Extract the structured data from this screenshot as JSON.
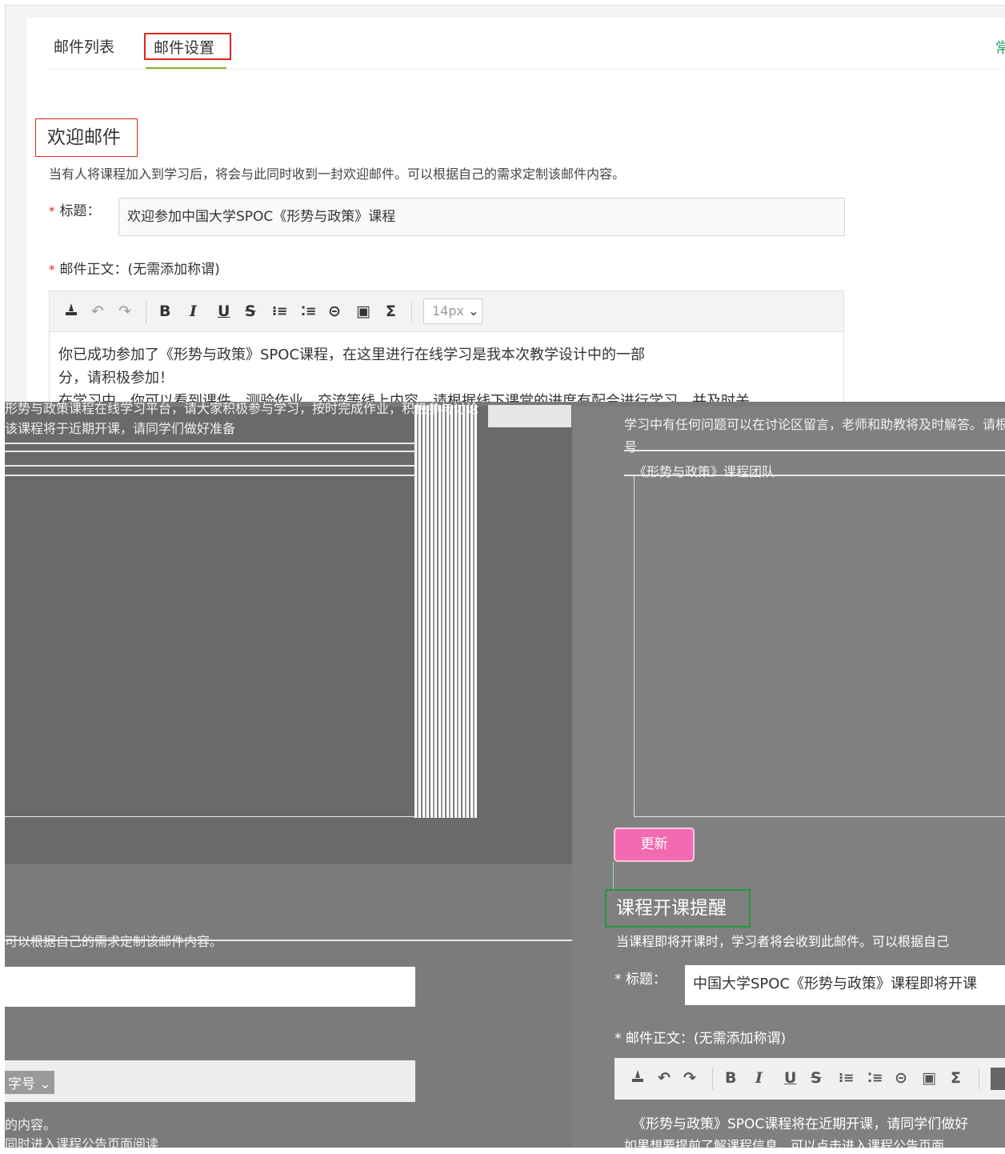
{
  "tabs": {
    "list_label": "邮件列表",
    "settings_label": "邮件设置",
    "right_cut": "常"
  },
  "welcome": {
    "title": "欢迎邮件",
    "description": "当有人将课程加入到学习后，将会与此同时收到一封欢迎邮件。可以根据自己的需求定制该邮件内容。",
    "required_mark": "*",
    "subject_label": "标题：",
    "subject_value": "欢迎参加中国大学SPOC《形势与政策》课程",
    "body_label": "邮件正文：(无需添加称谓)",
    "body_lines": [
      "你已成功参加了《形势与政策》SPOC课程，在这里进行在线学习是我本次教学设计中的一部",
      "分，请积极参加！",
      "在学习中，你可以看到课件、测验作业、交流等线上内容，请根据线下课堂的进度有配合进行学习，并及时关"
    ]
  },
  "toolbar": {
    "clear_icon": "clear-format-icon",
    "undo_glyph": "↶",
    "redo_glyph": "↷",
    "bold": "B",
    "italic": "I",
    "underline": "U",
    "strike": "S",
    "ordered_list_glyph": "⁝≡",
    "bullet_list_glyph": "⁚≡",
    "link_glyph": "⊝",
    "image_glyph": "▣",
    "formula": "Σ",
    "font_size": "14px"
  },
  "lower": {
    "ghost_left_1": "形势与政策课程在线学习平台，请大家积极参与学习，按时完成作业，积极参与讨论",
    "ghost_left_2": "该课程将于近期开课，请同学们做好准备",
    "ghost_right_1": "学习中有任何问题可以在讨论区留言，老师和助教将及时解答。请根据课程进度安排",
    "ghost_right_2": "号",
    "ghost_right_3": "《形势与政策》课程团队",
    "ghost_left_desc": "可以根据自己的需求定制该邮件内容。",
    "dropdown_cut": "字号",
    "ghost_left_body_1": "的内容。",
    "ghost_left_body_2": "同时进入课程公告页面阅读",
    "update_button": "更新",
    "reminder_title": "课程开课提醒",
    "reminder_desc": "当课程即将开课时，学习者将会收到此邮件。可以根据自己",
    "reminder_subject_label": "* 标题：",
    "reminder_subject_value": "中国大学SPOC《形势与政策》课程即将开课",
    "reminder_body_label": "* 邮件正文：(无需添加称谓)",
    "reminder_body_1": "《形势与政策》SPOC课程将在近期开课，请同学们做好",
    "reminder_body_2": "如果想要提前了解课程信息，可以点击进入课程公告页面"
  }
}
